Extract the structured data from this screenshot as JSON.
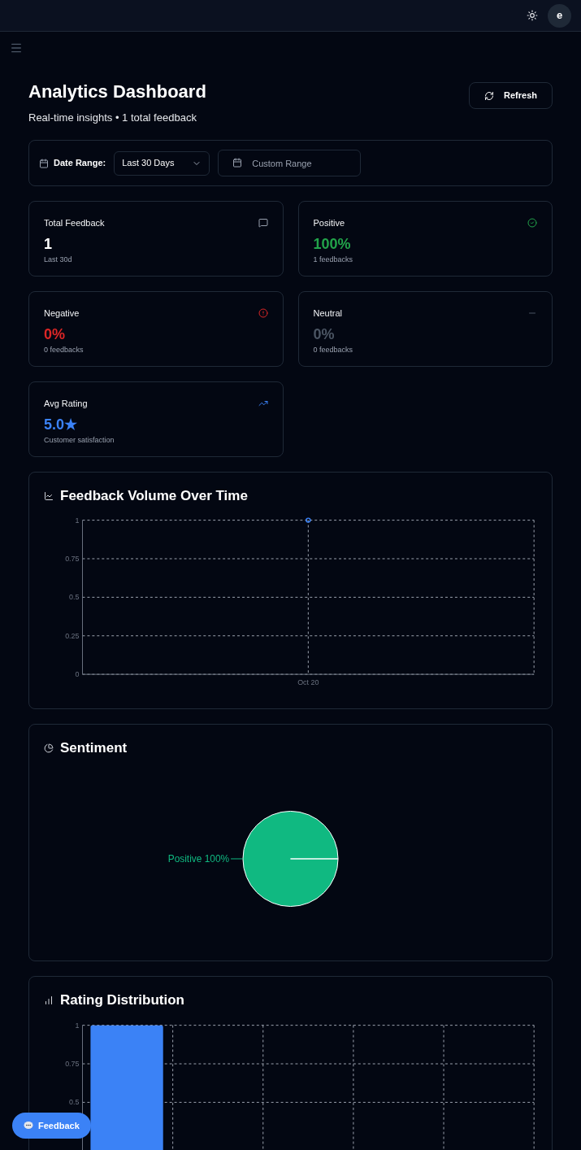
{
  "topbar": {
    "avatar": "e"
  },
  "header": {
    "title": "Analytics Dashboard",
    "subtitle": "Real-time insights • 1 total feedback",
    "refresh": "Refresh"
  },
  "filters": {
    "label": "Date Range:",
    "range": "Last 30 Days",
    "custom_placeholder": "Custom Range"
  },
  "stats": [
    {
      "kind": "total",
      "title": "Total Feedback",
      "value": "1",
      "note": "Last 30d",
      "color": "#ffffff"
    },
    {
      "kind": "positive",
      "title": "Positive",
      "value": "100%",
      "note": "1 feedbacks",
      "color": "#22a34a"
    },
    {
      "kind": "negative",
      "title": "Negative",
      "value": "0%",
      "note": "0 feedbacks",
      "color": "#dc2626"
    },
    {
      "kind": "neutral",
      "title": "Neutral",
      "value": "0%",
      "note": "0 feedbacks",
      "color": "#4b5563"
    },
    {
      "kind": "rating",
      "title": "Avg Rating",
      "value": "5.0★",
      "note": "Customer satisfaction",
      "color": "#3b82f6"
    }
  ],
  "volume": {
    "title": "Feedback Volume Over Time",
    "chart_data": {
      "type": "line",
      "x": [
        "Oct 20"
      ],
      "series": [
        {
          "color": "#3b82f6",
          "values": [
            1
          ],
          "marker": true
        }
      ],
      "ylim": [
        0,
        1
      ],
      "yticks": [
        0,
        0.25,
        0.5,
        0.75,
        1
      ],
      "grid": true
    }
  },
  "sentiment": {
    "title": "Sentiment",
    "chart_data": {
      "type": "pie",
      "series": [
        {
          "color": "#10b981",
          "values": [
            100
          ]
        }
      ],
      "value_labels": [
        "Positive 100%"
      ]
    }
  },
  "rating": {
    "title": "Rating Distribution",
    "chart_data": {
      "type": "bar",
      "series": [
        {
          "color": "#3b82f6",
          "values": [
            1,
            0,
            0,
            0,
            0
          ]
        }
      ],
      "ylim": [
        0,
        1
      ],
      "yticks": [
        0.5,
        0.75,
        1
      ],
      "grid": true
    }
  },
  "feedback_button": "Feedback"
}
